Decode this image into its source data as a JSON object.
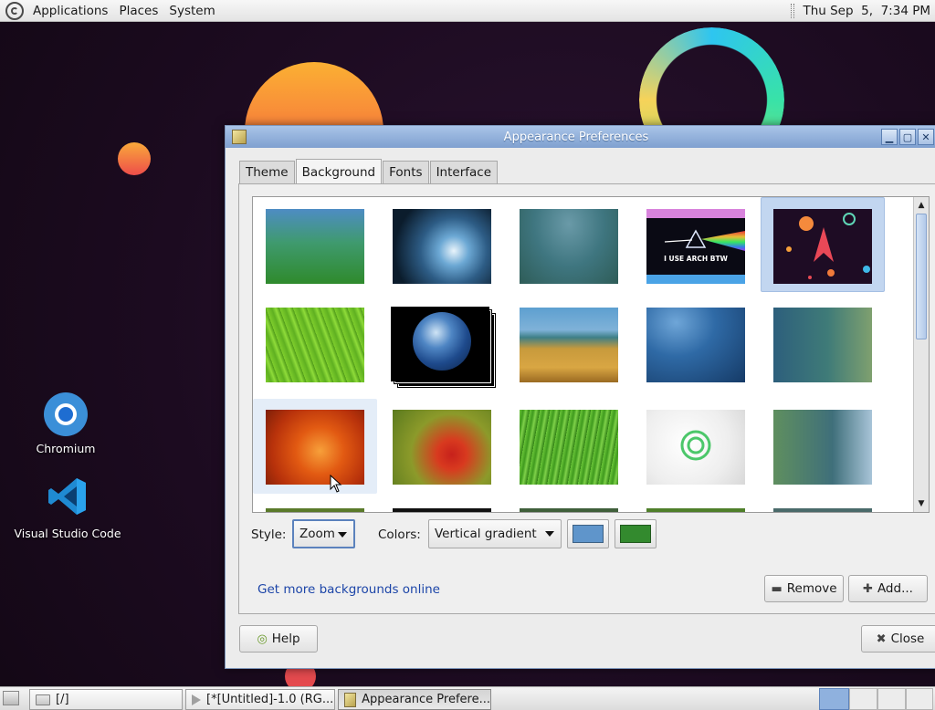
{
  "top_panel": {
    "menus": [
      "Applications",
      "Places",
      "System"
    ],
    "clock": "Thu Sep  5,  7:34 PM"
  },
  "desktop_icons": [
    {
      "label": "Chromium",
      "icon": "chromium-icon"
    },
    {
      "label": "Visual Studio Code",
      "icon": "vscode-icon"
    }
  ],
  "window": {
    "title": "Appearance Preferences",
    "tabs": [
      "Theme",
      "Background",
      "Fonts",
      "Interface"
    ],
    "active_tab": "Background",
    "wallpapers": [
      {
        "name": "blue-green-gradient",
        "selected": false
      },
      {
        "name": "water-drop",
        "selected": false
      },
      {
        "name": "teal-blur",
        "selected": false
      },
      {
        "name": "i-use-arch-btw",
        "text": "I USE ARCH BTW",
        "selected": false
      },
      {
        "name": "arch-planets-dark",
        "selected": true
      },
      {
        "name": "green-leaf",
        "selected": false
      },
      {
        "name": "earth-stack",
        "selected": false
      },
      {
        "name": "beach-grass",
        "selected": false
      },
      {
        "name": "blue-abstract",
        "selected": false
      },
      {
        "name": "teal-bokeh",
        "selected": false
      },
      {
        "name": "orange-flower",
        "selected": false,
        "hover": true
      },
      {
        "name": "red-flower",
        "selected": false
      },
      {
        "name": "green-grass",
        "selected": false
      },
      {
        "name": "white-logo",
        "selected": false
      },
      {
        "name": "teal-curves",
        "selected": false
      }
    ],
    "style_label": "Style:",
    "style_value": "Zoom",
    "colors_label": "Colors:",
    "colors_value": "Vertical gradient",
    "color_primary": "#5f95cb",
    "color_secondary": "#338a2e",
    "more_link": "Get more backgrounds online",
    "remove_label": "Remove",
    "add_label": "Add...",
    "help_label": "Help",
    "close_label": "Close"
  },
  "taskbar": {
    "items": [
      {
        "label": "[/]",
        "icon": "folder-icon"
      },
      {
        "label": "[*[Untitled]-1.0 (RG...",
        "icon": "gimp-icon"
      },
      {
        "label": "Appearance Prefere...",
        "icon": "preferences-icon",
        "active": true
      }
    ]
  }
}
